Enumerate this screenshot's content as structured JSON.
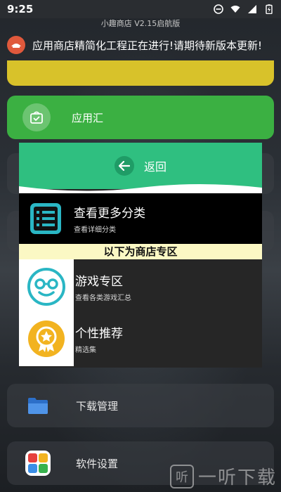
{
  "status": {
    "time": "9:25"
  },
  "app": {
    "subtitle": "小趣商店 V2.15启航版",
    "notice": "应用商店精简化工程正在进行!请期待新版本更新!"
  },
  "menu": {
    "app_hub": "应用汇",
    "download_manager": "下载管理",
    "software_settings": "软件设置"
  },
  "dialog": {
    "back_label": "返回",
    "more_categories": {
      "title": "查看更多分类",
      "subtitle": "查看详细分类"
    },
    "banner": "以下为商店专区",
    "game_zone": {
      "title": "游戏专区",
      "subtitle": "查看各类游戏汇总"
    },
    "recommend": {
      "title": "个性推荐",
      "subtitle": "精选集"
    }
  },
  "watermark": {
    "icon_text": "听",
    "text": "一听下载"
  },
  "colors": {
    "green": "#3bb042",
    "dialog_header": "#2fbf80",
    "banner": "#fbf8c4",
    "notice_badge": "#e0593c",
    "teal_icon": "#2ab6c4",
    "gold_icon": "#f2b320"
  }
}
